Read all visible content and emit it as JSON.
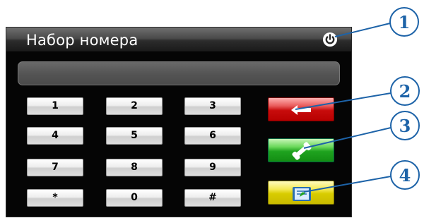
{
  "window": {
    "title": "Набор номера",
    "icons": {
      "power": "power-icon"
    }
  },
  "display": {
    "value": ""
  },
  "keypad": {
    "keys": [
      "1",
      "2",
      "3",
      "4",
      "5",
      "6",
      "7",
      "8",
      "9",
      "*",
      "0",
      "#"
    ]
  },
  "actions": {
    "backspace": {
      "icon": "backspace-arrow-icon",
      "color": "#c80c0c"
    },
    "call": {
      "icon": "phone-handset-icon",
      "color": "#1fa31f"
    },
    "contacts": {
      "icon": "phonebook-icon",
      "color": "#d8cc00"
    }
  },
  "callouts": [
    "1",
    "2",
    "3",
    "4"
  ],
  "colors": {
    "callout": "#1d63a8",
    "background": "#050505"
  }
}
